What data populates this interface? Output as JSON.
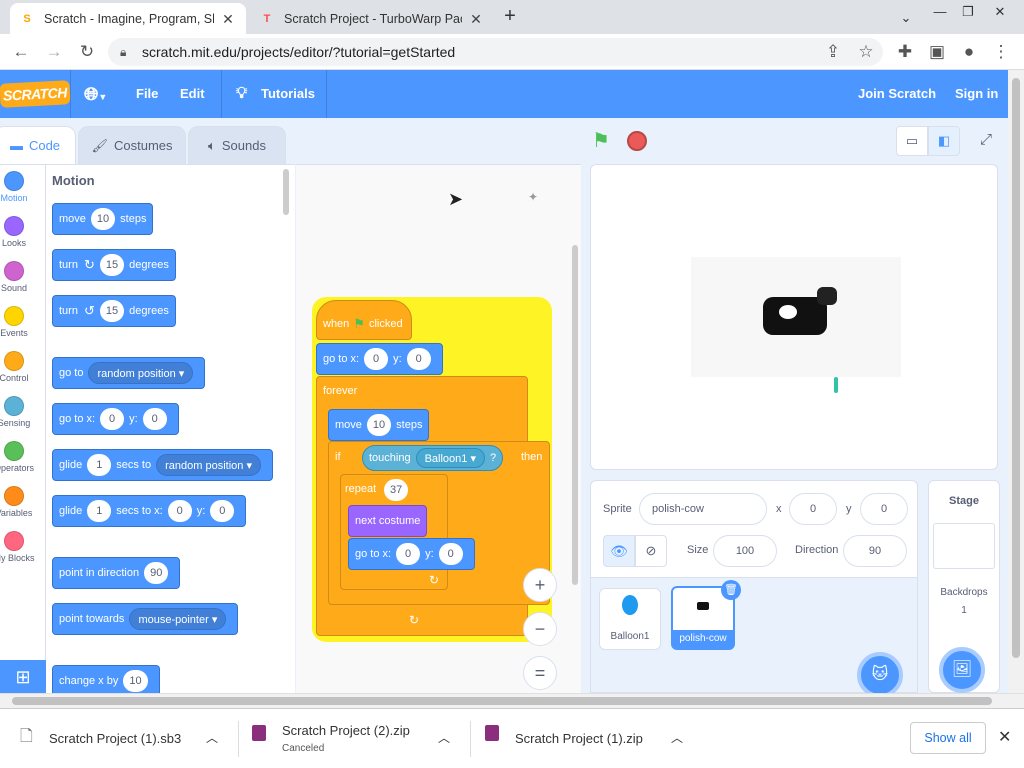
{
  "browser": {
    "tabs": [
      {
        "title": "Scratch - Imagine, Program, Shar",
        "favicon": "scratch-cat-icon",
        "active": true
      },
      {
        "title": "Scratch Project - TurboWarp Pack",
        "favicon": "turbowarp-icon",
        "active": false
      }
    ],
    "new_tab": "+",
    "url": "scratch.mit.edu/projects/editor/?tutorial=getStarted"
  },
  "menu": {
    "logo": "SCRATCH",
    "file": "File",
    "edit": "Edit",
    "tutorials": "Tutorials",
    "join": "Join Scratch",
    "signin": "Sign in"
  },
  "editor_tabs": {
    "code": "Code",
    "costumes": "Costumes",
    "sounds": "Sounds"
  },
  "categories": [
    {
      "label": "Motion",
      "color": "#4c97ff"
    },
    {
      "label": "Looks",
      "color": "#9966ff"
    },
    {
      "label": "Sound",
      "color": "#cf63cf"
    },
    {
      "label": "Events",
      "color": "#ffd500"
    },
    {
      "label": "Control",
      "color": "#ffab19"
    },
    {
      "label": "Sensing",
      "color": "#5cb1d6"
    },
    {
      "label": "Operators",
      "color": "#59c059"
    },
    {
      "label": "Variables",
      "color": "#ff8c1a"
    },
    {
      "label": "My Blocks",
      "color": "#ff6680"
    }
  ],
  "palette": {
    "heading": "Motion",
    "move": {
      "a": "move",
      "n": "10",
      "b": "steps"
    },
    "turn_right": {
      "a": "turn",
      "n": "15",
      "b": "degrees"
    },
    "turn_left": {
      "a": "turn",
      "n": "15",
      "b": "degrees"
    },
    "goto": {
      "a": "go to",
      "d": "random position"
    },
    "gotoxy": {
      "a": "go to x:",
      "x": "0",
      "b": "y:",
      "y": "0"
    },
    "glide": {
      "a": "glide",
      "n": "1",
      "b": "secs to",
      "d": "random position"
    },
    "glidexy": {
      "a": "glide",
      "n": "1",
      "b": "secs to x:",
      "x": "0",
      "c": "y:",
      "y": "0"
    },
    "point_dir": {
      "a": "point in direction",
      "n": "90"
    },
    "point_towards": {
      "a": "point towards",
      "d": "mouse-pointer"
    },
    "change_x": {
      "a": "change x by",
      "n": "10"
    }
  },
  "script": {
    "hat": {
      "a": "when",
      "b": "clicked"
    },
    "gotoxy": {
      "a": "go to x:",
      "x": "0",
      "b": "y:",
      "y": "0"
    },
    "forever": "forever",
    "move": {
      "a": "move",
      "n": "10",
      "b": "steps"
    },
    "if": {
      "a": "if",
      "then": "then"
    },
    "touching": {
      "a": "touching",
      "d": "Balloon1",
      "q": "?"
    },
    "repeat": {
      "a": "repeat",
      "n": "37"
    },
    "next_costume": "next costume",
    "gotoxy2": {
      "a": "go to x:",
      "x": "0",
      "b": "y:",
      "y": "0"
    }
  },
  "zoom": {
    "in": "+",
    "out": "−",
    "reset": "="
  },
  "sprite_info": {
    "sprite_label": "Sprite",
    "sprite_name": "polish-cow",
    "x_label": "x",
    "x": "0",
    "y_label": "y",
    "y": "0",
    "size_label": "Size",
    "size": "100",
    "direction_label": "Direction",
    "direction": "90"
  },
  "sprites": [
    {
      "name": "Balloon1",
      "selected": false
    },
    {
      "name": "polish-cow",
      "selected": true
    }
  ],
  "stage_pane": {
    "title": "Stage",
    "backdrops_label": "Backdrops",
    "backdrops_count": "1"
  },
  "downloads": [
    {
      "name": "Scratch Project (1).sb3",
      "status": ""
    },
    {
      "name": "Scratch Project (2).zip",
      "status": "Canceled"
    },
    {
      "name": "Scratch Project (1).zip",
      "status": ""
    }
  ],
  "show_all": "Show all"
}
